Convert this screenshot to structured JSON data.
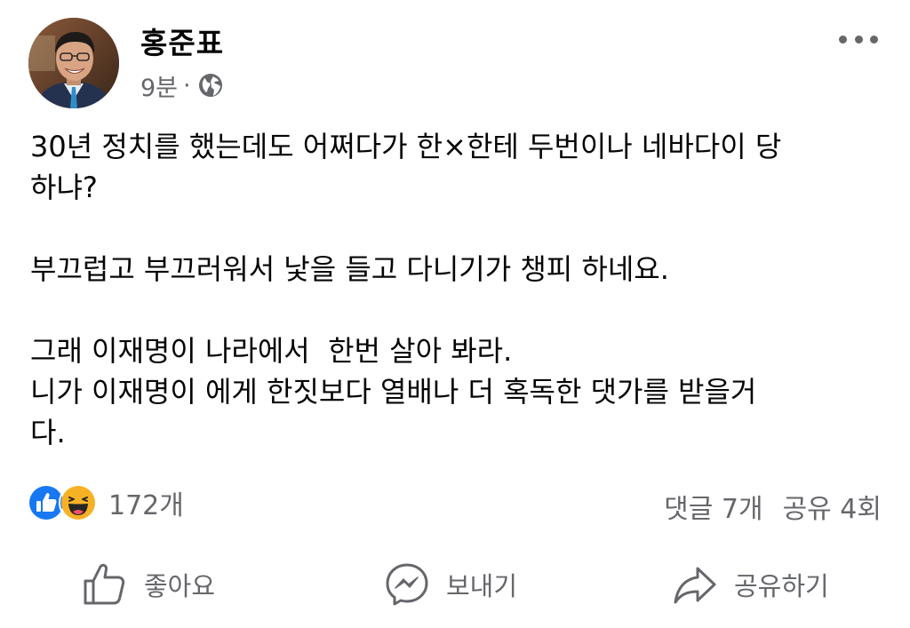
{
  "post": {
    "author": "홍준표",
    "time": "9분",
    "separator": "·",
    "privacy_icon": "globe-icon",
    "menu_icon": "more-horizontal-icon",
    "body": [
      "30년 정치를 했는데도 어쩌다가 한×한테 두번이나 네바다이 당\n하냐?",
      "부끄럽고 부끄러워서 낯을 들고 다니기가 챙피 하네요.",
      "그래 이재명이 나라에서  한번 살아 봐라.\n니가 이재명이 에게 한짓보다 열배나 더 혹독한 댓가를 받을거\n다."
    ]
  },
  "stats": {
    "reaction_icons": [
      "like-reaction-icon",
      "haha-reaction-icon"
    ],
    "reaction_count": "172개",
    "comments": "댓글 7개",
    "shares": "공유 4회"
  },
  "actions": {
    "like": "좋아요",
    "send": "보내기",
    "share": "공유하기"
  },
  "colors": {
    "text": "#050505",
    "secondary": "#65676b",
    "like_blue": "#1877f2",
    "haha_yellow": "#f7b125"
  }
}
